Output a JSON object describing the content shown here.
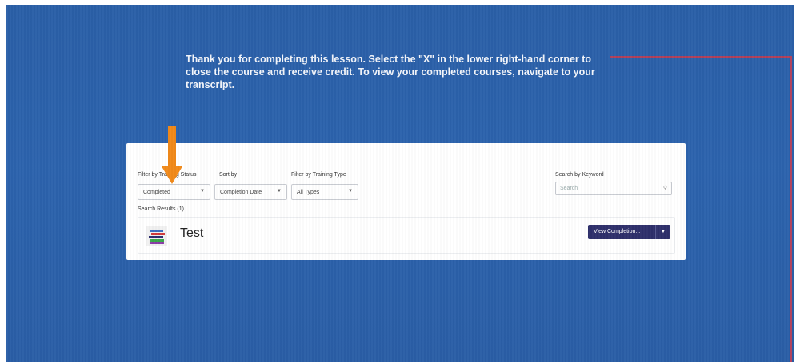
{
  "message": {
    "text": "Thank you for completing this lesson. Select the \"X\" in the lower right-hand corner to close the course and receive credit. To view your completed courses, navigate to your transcript."
  },
  "filters": {
    "status_label": "Filter by Training Status",
    "status_value": "Completed",
    "sort_label": "Sort by",
    "sort_value": "Completion Date",
    "type_label": "Filter by Training Type",
    "type_value": "All Types",
    "keyword_label": "Search by Keyword",
    "keyword_placeholder": "Search"
  },
  "results": {
    "count_label": "Search Results (1)",
    "items": [
      {
        "title": "Test",
        "action_label": "View Completion..."
      }
    ]
  },
  "colors": {
    "background": "#2c63ad",
    "callout_line": "#b0405a",
    "arrow": "#f28a1a",
    "button": "#2e2f6b"
  },
  "icons": {
    "arrow": "orange-down-arrow-icon",
    "course": "course-books-icon",
    "search": "search-icon",
    "caret": "caret-down-icon"
  }
}
